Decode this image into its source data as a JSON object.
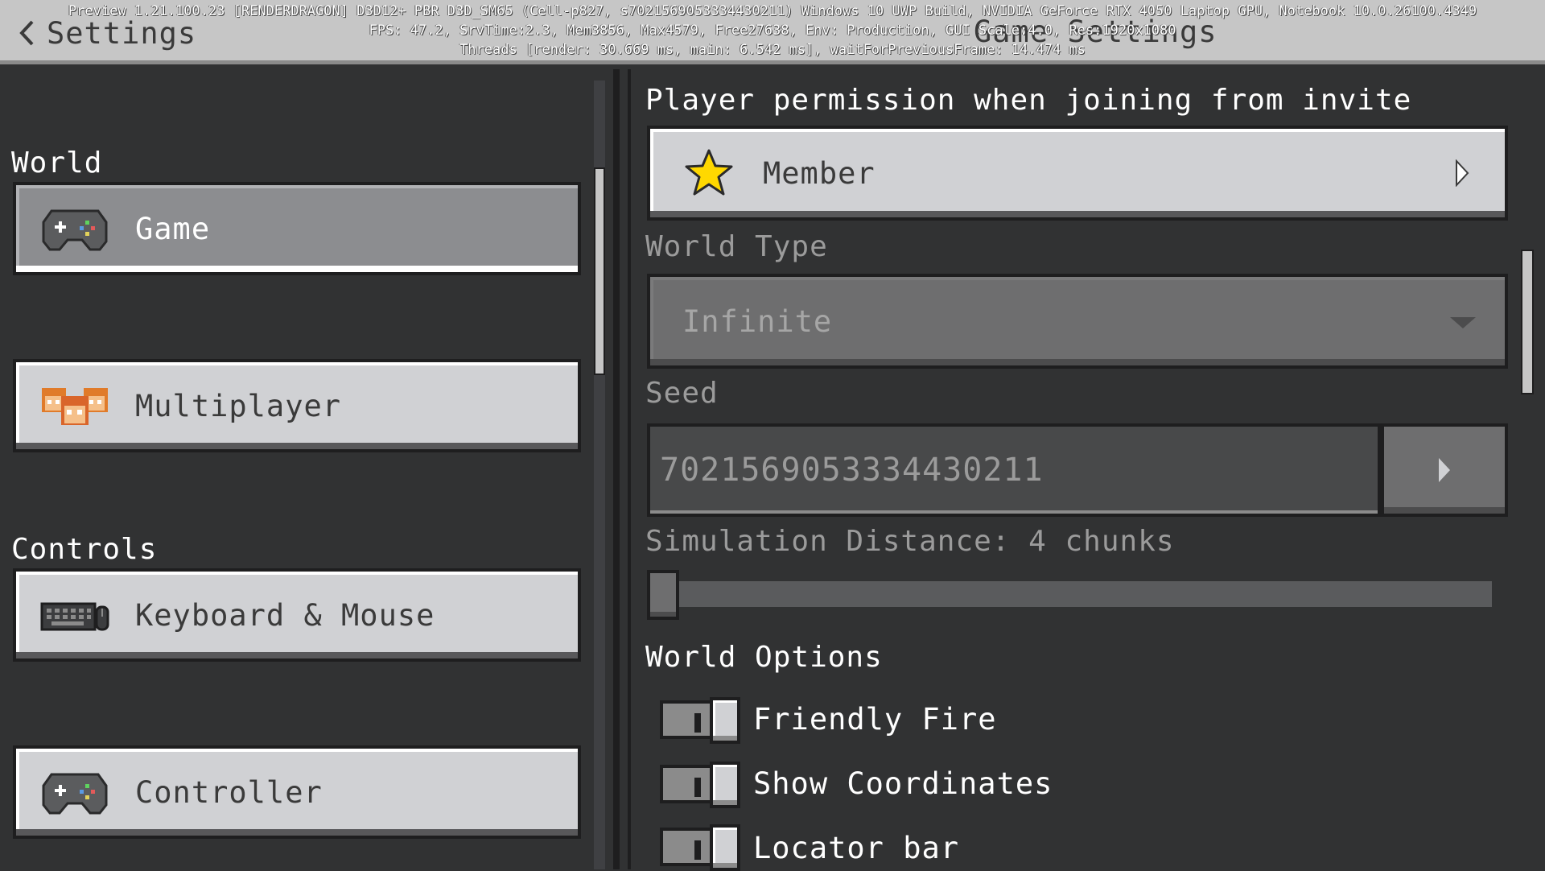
{
  "debug": {
    "line1": "Preview 1.21.100.23 [RENDERDRAGON] D3D12+ PBR D3D_SM65 (Cell-p827, s7021569053334430211) Windows 10 UWP Build, NVIDIA GeForce RTX 4050 Laptop GPU, Notebook 10.0.26100.4349",
    "line2": "FPS: 47.2, SrvTime:2.3, Mem3856, Max4579, Free27638, Env: Production, GUI Scale:4.0, Res:1920x1080",
    "line3": "Threads [render: 30.669 ms, main: 6.542 ms], waitForPreviousFrame: 14.474 ms"
  },
  "header": {
    "back_label": "Settings",
    "title": "Game Settings"
  },
  "sidebar": {
    "sections": [
      {
        "label": "World",
        "items": [
          {
            "label": "Game",
            "icon": "gamepad-icon",
            "selected": true
          },
          {
            "label": "Multiplayer",
            "icon": "players-icon",
            "selected": false
          }
        ]
      },
      {
        "label": "Controls",
        "items": [
          {
            "label": "Keyboard & Mouse",
            "icon": "keyboard-icon",
            "selected": false
          },
          {
            "label": "Controller",
            "icon": "gamepad-icon",
            "selected": false
          }
        ]
      }
    ]
  },
  "settings": {
    "invite_permission": {
      "label": "Player permission when joining from invite",
      "value": "Member",
      "icon": "star-icon"
    },
    "world_type": {
      "label": "World Type",
      "value": "Infinite",
      "disabled": true
    },
    "seed": {
      "label": "Seed",
      "value": "7021569053334430211"
    },
    "simulation_distance": {
      "label": "Simulation Distance: 4 chunks",
      "value": 4,
      "min_fraction": 0.0
    },
    "world_options": {
      "label": "World Options",
      "toggles": [
        {
          "label": "Friendly Fire",
          "on": true
        },
        {
          "label": "Show Coordinates",
          "on": true
        },
        {
          "label": "Locator bar",
          "on": true
        }
      ]
    }
  },
  "colors": {
    "panel_bg": "#313233",
    "button_bg": "#d0d1d4",
    "selected_bg": "#8c8d90",
    "topbar_bg": "#c6c6c6",
    "star": "#ffd800"
  }
}
